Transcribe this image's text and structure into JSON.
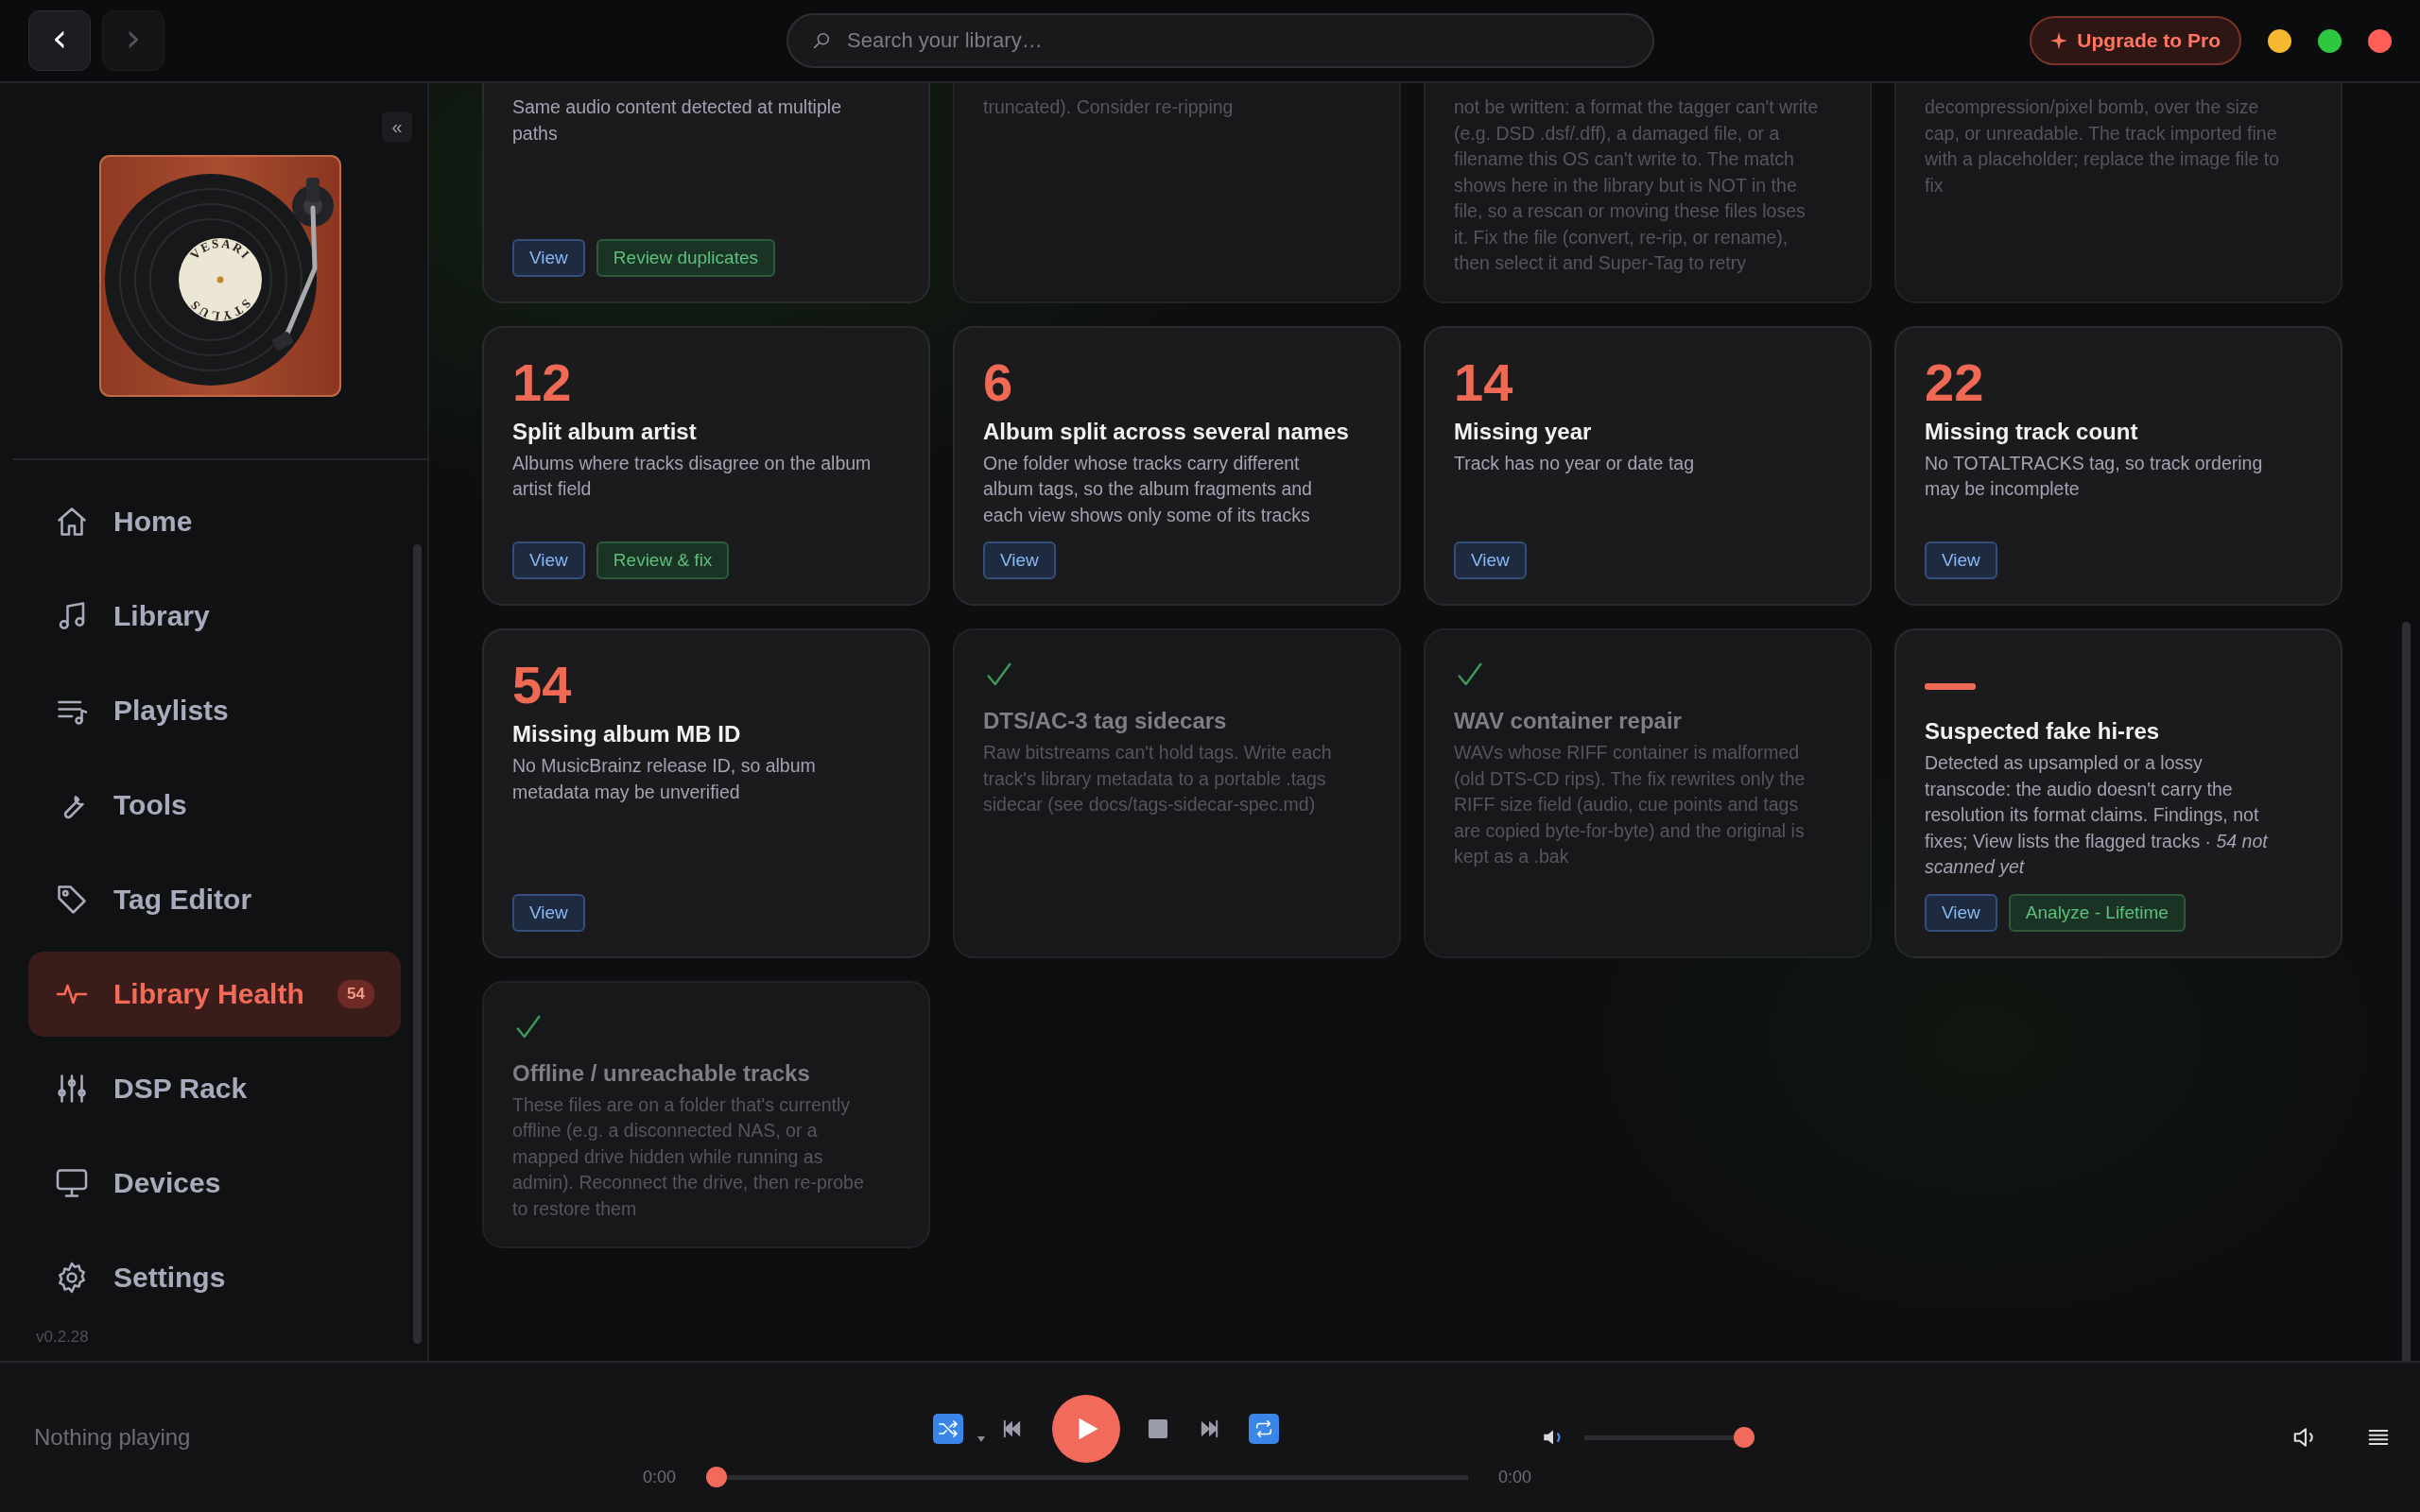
{
  "topbar": {
    "nav_buttons": [
      {
        "label": "‹",
        "disabled": false
      },
      {
        "label": "›",
        "disabled": true
      }
    ],
    "search": {
      "placeholder": "Search your library…"
    },
    "upgrade_button": {
      "label": "Upgrade to Pro"
    },
    "window_controls": [
      {
        "color": "#f5b82e"
      },
      {
        "color": "#2ec840"
      },
      {
        "color": "#ff5f57"
      }
    ]
  },
  "sidebar": {
    "collapse_button": "«",
    "logo": {
      "top_text": "VESARI",
      "bottom_text": "STYLUS"
    },
    "items": [
      {
        "label": "Home",
        "selected": false
      },
      {
        "label": "Library",
        "selected": false
      },
      {
        "label": "Playlists",
        "selected": false
      },
      {
        "label": "Tools",
        "selected": false
      },
      {
        "label": "Tag Editor",
        "selected": false
      },
      {
        "label": "Library Health",
        "selected": true,
        "badge": "54"
      },
      {
        "label": "DSP Rack",
        "selected": false
      },
      {
        "label": "Devices",
        "selected": false
      },
      {
        "label": "Settings",
        "selected": false
      }
    ],
    "version": "v0.2.28"
  },
  "cards": [
    {
      "kind": "count",
      "description": "Same audio content detected at multiple paths",
      "buttons": [
        {
          "label": "View",
          "kind": "view"
        },
        {
          "label": "Review duplicates",
          "kind": "action"
        }
      ]
    },
    {
      "kind": "ok",
      "description": "truncated). Consider re-ripping"
    },
    {
      "kind": "ok",
      "description": "not be written: a format the tagger can't write (e.g. DSD .dsf/.dff), a damaged file, or a filename this OS can't write to. The match shows here in the library but is NOT in the file, so a rescan or moving these files loses it. Fix the file (convert, re-rip, or rename), then select it and Super-Tag to retry"
    },
    {
      "kind": "ok",
      "description": "decompression/pixel bomb, over the size cap, or unreadable. The track imported fine with a placeholder; replace the image file to fix"
    },
    {
      "kind": "count",
      "count": "12",
      "title": "Split album artist",
      "description": "Albums where tracks disagree on the album artist field",
      "buttons": [
        {
          "label": "View",
          "kind": "view"
        },
        {
          "label": "Review & fix",
          "kind": "action"
        }
      ]
    },
    {
      "kind": "count",
      "count": "6",
      "title": "Album split across several names",
      "description": "One folder whose tracks carry different album tags, so the album fragments and each view shows only some of its tracks",
      "buttons": [
        {
          "label": "View",
          "kind": "view"
        }
      ]
    },
    {
      "kind": "count",
      "count": "14",
      "title": "Missing year",
      "description": "Track has no year or date tag",
      "buttons": [
        {
          "label": "View",
          "kind": "view"
        }
      ]
    },
    {
      "kind": "count",
      "count": "22",
      "title": "Missing track count",
      "description": "No TOTALTRACKS tag, so track ordering may be incomplete",
      "buttons": [
        {
          "label": "View",
          "kind": "view"
        }
      ]
    },
    {
      "kind": "count",
      "count": "54",
      "title": "Missing album MB ID",
      "description": "No MusicBrainz release ID, so album metadata may be unverified",
      "buttons": [
        {
          "label": "View",
          "kind": "view"
        }
      ]
    },
    {
      "kind": "ok",
      "title": "DTS/AC-3 tag sidecars",
      "description": "Raw bitstreams can't hold tags. Write each track's library metadata to a portable .tags sidecar (see docs/tags-sidecar-spec.md)"
    },
    {
      "kind": "ok",
      "title": "WAV container repair",
      "description": "WAVs whose RIFF container is malformed (old DTS-CD rips). The fix rewrites only the RIFF size field (audio, cue points and tags are copied byte-for-byte) and the original is kept as a .bak"
    },
    {
      "kind": "pending",
      "title": "Suspected fake hi-res",
      "description": "Detected as upsampled or a lossy transcode: the audio doesn't carry the resolution its format claims. Findings, not fixes; View lists the flagged tracks · *54 not scanned yet*",
      "buttons": [
        {
          "label": "View",
          "kind": "view"
        },
        {
          "label": "Analyze - Lifetime",
          "kind": "action"
        }
      ]
    },
    {
      "kind": "ok",
      "title": "Offline / unreachable tracks",
      "description": "These files are on a folder that's currently offline (e.g. a disconnected NAS, or a mapped drive hidden while running as admin). Reconnect the drive, then re-probe to restore them"
    }
  ],
  "player": {
    "now_playing": "Nothing playing",
    "shuffle": {
      "on": true
    },
    "repeat": {
      "on": true
    },
    "elapsed": "0:00",
    "duration": "0:00",
    "progress": {
      "level": 0
    },
    "volume": {
      "level": 1
    }
  }
}
